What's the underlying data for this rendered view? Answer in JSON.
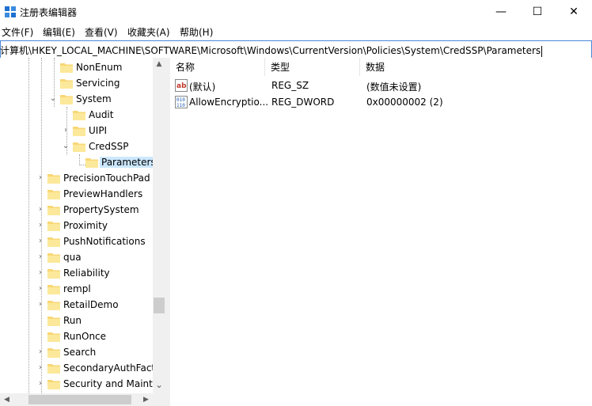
{
  "window": {
    "title": "注册表编辑器",
    "buttons": {
      "minimize": "—",
      "maximize": "☐",
      "close": "✕"
    }
  },
  "menu": [
    "文件(F)",
    "编辑(E)",
    "查看(V)",
    "收藏夹(A)",
    "帮助(H)"
  ],
  "address": "计算机\\HKEY_LOCAL_MACHINE\\SOFTWARE\\Microsoft\\Windows\\CurrentVersion\\Policies\\System\\CredSSP\\Parameters",
  "tree": {
    "items": [
      {
        "label": "NonEnum",
        "expander": ""
      },
      {
        "label": "Servicing",
        "expander": ""
      },
      {
        "label": "System",
        "expander": "⌄"
      },
      {
        "label": "Audit",
        "expander": ""
      },
      {
        "label": "UIPI",
        "expander": "›"
      },
      {
        "label": "CredSSP",
        "expander": "⌄"
      },
      {
        "label": "Parameters",
        "expander": ""
      },
      {
        "label": "PrecisionTouchPad",
        "expander": "›"
      },
      {
        "label": "PreviewHandlers",
        "expander": ""
      },
      {
        "label": "PropertySystem",
        "expander": "›"
      },
      {
        "label": "Proximity",
        "expander": "›"
      },
      {
        "label": "PushNotifications",
        "expander": "›"
      },
      {
        "label": "qua",
        "expander": "›"
      },
      {
        "label": "Reliability",
        "expander": "›"
      },
      {
        "label": "rempl",
        "expander": "›"
      },
      {
        "label": "RetailDemo",
        "expander": "›"
      },
      {
        "label": "Run",
        "expander": ""
      },
      {
        "label": "RunOnce",
        "expander": ""
      },
      {
        "label": "Search",
        "expander": "›"
      },
      {
        "label": "SecondaryAuthFacto",
        "expander": "›"
      },
      {
        "label": "Security and Mainte",
        "expander": "›"
      }
    ]
  },
  "list": {
    "columns": [
      "名称",
      "类型",
      "数据"
    ],
    "rows": [
      {
        "name": "(默认)",
        "type": "REG_SZ",
        "data": "(数值未设置)"
      },
      {
        "name": "AllowEncryptio...",
        "type": "REG_DWORD",
        "data": "0x00000002 (2)"
      }
    ]
  },
  "scroll": {
    "up": "▲",
    "down": "⌄",
    "left": "◀",
    "right": "▶"
  }
}
